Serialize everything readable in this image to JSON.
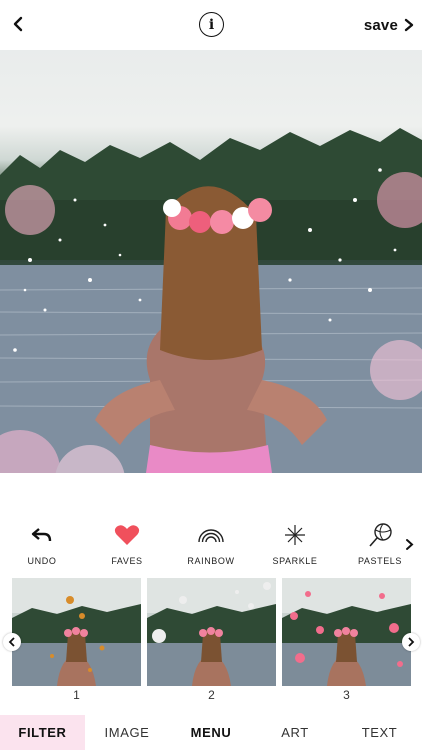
{
  "topbar": {
    "save_label": "save"
  },
  "tools": [
    {
      "label": "UNDO",
      "icon": "undo-icon"
    },
    {
      "label": "FAVES",
      "icon": "heart-icon"
    },
    {
      "label": "RAINBOW",
      "icon": "rainbow-icon"
    },
    {
      "label": "SPARKLE",
      "icon": "sparkle-icon"
    },
    {
      "label": "PASTELS",
      "icon": "lollipop-icon"
    }
  ],
  "thumbnails": [
    {
      "number": "1"
    },
    {
      "number": "2"
    },
    {
      "number": "3"
    }
  ],
  "tabs": [
    {
      "label": "FILTER"
    },
    {
      "label": "IMAGE"
    },
    {
      "label": "MENU"
    },
    {
      "label": "ART"
    },
    {
      "label": "TEXT"
    }
  ],
  "colors": {
    "heart": "#f0505c",
    "active_tab_bg": "#fbe3ee"
  }
}
